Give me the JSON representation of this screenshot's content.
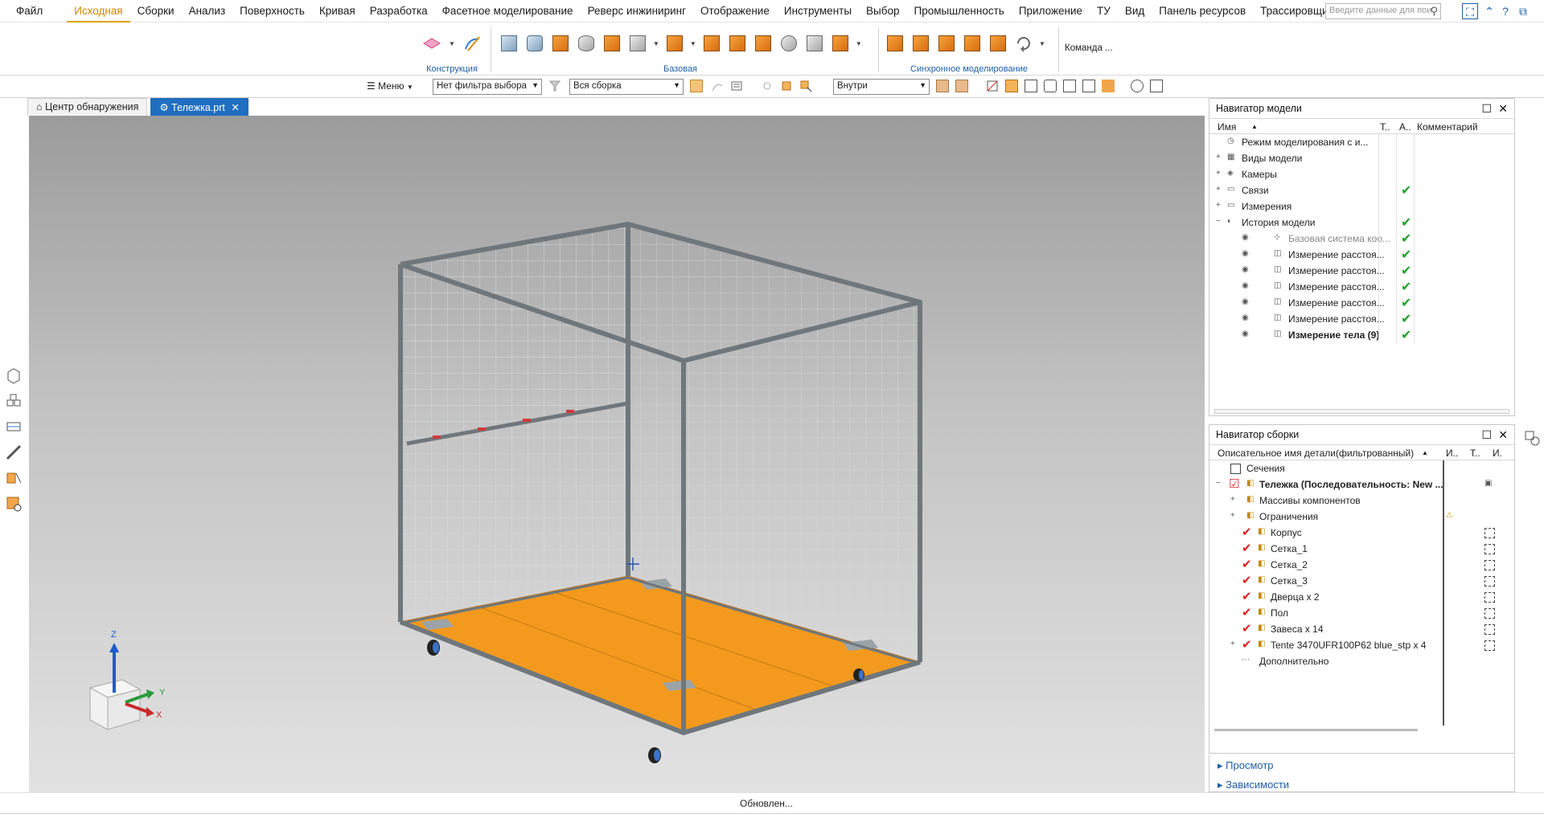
{
  "menu": {
    "items": [
      "Файл",
      "Исходная",
      "Сборки",
      "Анализ",
      "Поверхность",
      "Кривая",
      "Разработка",
      "Фасетное моделирование",
      "Реверс инжиниринг",
      "Отображение",
      "Инструменты",
      "Выбор",
      "Промышленность",
      "Приложение",
      "ТУ",
      "Вид",
      "Панель ресурсов",
      "Трассировщик кабелей"
    ],
    "active_index": 1,
    "search_placeholder": "Введите данные для пои"
  },
  "ribbon": {
    "groups": [
      "Конструкция",
      "Базовая",
      "Синхронное моделирование"
    ],
    "command_finder": "Команда ..."
  },
  "selection_toolbar": {
    "menu_label": "Меню",
    "filter": "Нет фильтра выбора",
    "scope": "Вся сборка",
    "mode": "Внутри"
  },
  "tabs": [
    {
      "label": "Центр обнаружения",
      "icon": "discovery-icon"
    },
    {
      "label": "Тележка.prt",
      "icon": "part-icon",
      "close": "✕"
    }
  ],
  "viewport": {
    "triad": {
      "z": "Z",
      "y": "Y",
      "x": "X"
    }
  },
  "model_navigator": {
    "title": "Навигатор модели",
    "columns": [
      "Имя",
      "Т..",
      "А..",
      "Комментарий"
    ],
    "rows": [
      {
        "label": "Режим моделирования с и...",
        "icon": "clock-icon",
        "check": false,
        "dim": false,
        "bold": false,
        "level": 0
      },
      {
        "label": "Виды модели",
        "icon": "views-icon",
        "check": false,
        "dim": false,
        "bold": false,
        "level": 0
      },
      {
        "label": "Камеры",
        "icon": "camera-icon",
        "check": false,
        "dim": false,
        "bold": false,
        "level": 0
      },
      {
        "label": "Связи",
        "icon": "folder-icon",
        "check": true,
        "dim": false,
        "bold": false,
        "level": 0
      },
      {
        "label": "Измерения",
        "icon": "folder-icon",
        "check": false,
        "dim": false,
        "bold": false,
        "level": 0
      },
      {
        "label": "История модели",
        "icon": "history-icon",
        "check": true,
        "dim": false,
        "bold": false,
        "level": 0
      },
      {
        "label": "Базовая система коо...",
        "icon": "csys-icon",
        "check": true,
        "dim": true,
        "bold": false,
        "level": 1
      },
      {
        "label": "Измерение расстоя...",
        "icon": "measure-icon",
        "check": true,
        "dim": false,
        "bold": false,
        "level": 1
      },
      {
        "label": "Измерение расстоя...",
        "icon": "measure-icon",
        "check": true,
        "dim": false,
        "bold": false,
        "level": 1
      },
      {
        "label": "Измерение расстоя...",
        "icon": "measure-icon",
        "check": true,
        "dim": false,
        "bold": false,
        "level": 1
      },
      {
        "label": "Измерение расстоя...",
        "icon": "measure-icon",
        "check": true,
        "dim": false,
        "bold": false,
        "level": 1
      },
      {
        "label": "Измерение расстоя...",
        "icon": "measure-icon",
        "check": true,
        "dim": false,
        "bold": false,
        "level": 1
      },
      {
        "label": "Измерение тела (9)",
        "icon": "measure-icon",
        "check": true,
        "dim": false,
        "bold": true,
        "level": 1
      }
    ]
  },
  "assembly_navigator": {
    "title": "Навигатор сборки",
    "columns": [
      "Описательное имя детали(фильтрованный)",
      "И..",
      "Т..",
      "И."
    ],
    "rows": [
      {
        "label": "Сечения",
        "bold": false
      },
      {
        "label": "Тележка (Последовательность: New ...",
        "bold": true
      },
      {
        "label": "Массивы компонентов",
        "bold": false
      },
      {
        "label": "Ограничения",
        "bold": false
      },
      {
        "label": "Корпус",
        "bold": false
      },
      {
        "label": "Сетка_1",
        "bold": false
      },
      {
        "label": "Сетка_2",
        "bold": false
      },
      {
        "label": "Сетка_3",
        "bold": false
      },
      {
        "label": "Дверца x 2",
        "bold": false
      },
      {
        "label": "Пол",
        "bold": false
      },
      {
        "label": "Завеса x 14",
        "bold": false
      },
      {
        "label": "Tente 3470UFR100P62 blue_stp x 4",
        "bold": false
      },
      {
        "label": "Дополнительно",
        "bold": false
      }
    ]
  },
  "collapsed_panels": [
    "Просмотр",
    "Зависимости"
  ],
  "status": {
    "text": "Обновлен..."
  },
  "colors": {
    "accent_blue": "#1f6ec0",
    "active_menu": "#e0a000",
    "floor_orange": "#f39a1e",
    "check_green": "#22a12b"
  }
}
